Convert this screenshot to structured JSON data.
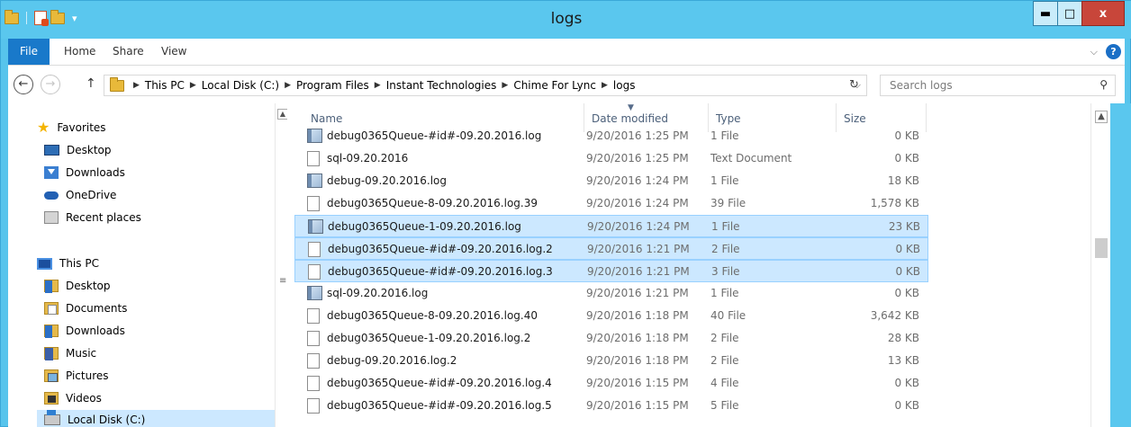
{
  "window": {
    "title": "logs",
    "controls": {
      "minimize": "▬",
      "maximize": "□",
      "close": "x"
    }
  },
  "ribbon": {
    "tabs": [
      "File",
      "Home",
      "Share",
      "View"
    ],
    "expand_glyph": "⌵",
    "help_glyph": "?"
  },
  "nav": {
    "back": "←",
    "forward": "→",
    "up": "↑",
    "breadcrumbs": [
      "This PC",
      "Local Disk (C:)",
      "Program Files",
      "Instant Technologies",
      "Chime For Lync",
      "logs"
    ],
    "crumb_sep": "▶",
    "dropdown_glyph": "⌵",
    "refresh_glyph": "↻",
    "search_placeholder": "Search logs",
    "search_glyph": "⚲"
  },
  "sidebar": {
    "favorites_label": "Favorites",
    "favorites": [
      "Desktop",
      "Downloads",
      "OneDrive",
      "Recent places"
    ],
    "thispc_label": "This PC",
    "thispc": [
      "Desktop",
      "Documents",
      "Downloads",
      "Music",
      "Pictures",
      "Videos",
      "Local Disk (C:)"
    ]
  },
  "columns": {
    "name": "Name",
    "date": "Date modified",
    "type": "Type",
    "size": "Size"
  },
  "files": [
    {
      "name": "debug0365Queue-#id#-09.20.2016.log",
      "date": "9/20/2016 1:25 PM",
      "type": "1 File",
      "size": "0 KB",
      "icon": "log-icon",
      "selected": false
    },
    {
      "name": "sql-09.20.2016",
      "date": "9/20/2016 1:25 PM",
      "type": "Text Document",
      "size": "0 KB",
      "icon": "file-icon",
      "selected": false
    },
    {
      "name": "debug-09.20.2016.log",
      "date": "9/20/2016 1:24 PM",
      "type": "1 File",
      "size": "18 KB",
      "icon": "log-icon",
      "selected": false
    },
    {
      "name": "debug0365Queue-8-09.20.2016.log.39",
      "date": "9/20/2016 1:24 PM",
      "type": "39 File",
      "size": "1,578 KB",
      "icon": "file-icon",
      "selected": false
    },
    {
      "name": "debug0365Queue-1-09.20.2016.log",
      "date": "9/20/2016 1:24 PM",
      "type": "1 File",
      "size": "23 KB",
      "icon": "log-icon",
      "selected": true
    },
    {
      "name": "debug0365Queue-#id#-09.20.2016.log.2",
      "date": "9/20/2016 1:21 PM",
      "type": "2 File",
      "size": "0 KB",
      "icon": "file-icon",
      "selected": true
    },
    {
      "name": "debug0365Queue-#id#-09.20.2016.log.3",
      "date": "9/20/2016 1:21 PM",
      "type": "3 File",
      "size": "0 KB",
      "icon": "file-icon",
      "selected": true
    },
    {
      "name": "sql-09.20.2016.log",
      "date": "9/20/2016 1:21 PM",
      "type": "1 File",
      "size": "0 KB",
      "icon": "log-icon",
      "selected": false
    },
    {
      "name": "debug0365Queue-8-09.20.2016.log.40",
      "date": "9/20/2016 1:18 PM",
      "type": "40 File",
      "size": "3,642 KB",
      "icon": "file-icon",
      "selected": false
    },
    {
      "name": "debug0365Queue-1-09.20.2016.log.2",
      "date": "9/20/2016 1:18 PM",
      "type": "2 File",
      "size": "28 KB",
      "icon": "file-icon",
      "selected": false
    },
    {
      "name": "debug-09.20.2016.log.2",
      "date": "9/20/2016 1:18 PM",
      "type": "2 File",
      "size": "13 KB",
      "icon": "file-icon",
      "selected": false
    },
    {
      "name": "debug0365Queue-#id#-09.20.2016.log.4",
      "date": "9/20/2016 1:15 PM",
      "type": "4 File",
      "size": "0 KB",
      "icon": "file-icon",
      "selected": false
    },
    {
      "name": "debug0365Queue-#id#-09.20.2016.log.5",
      "date": "9/20/2016 1:15 PM",
      "type": "5 File",
      "size": "0 KB",
      "icon": "file-icon",
      "selected": false
    }
  ]
}
